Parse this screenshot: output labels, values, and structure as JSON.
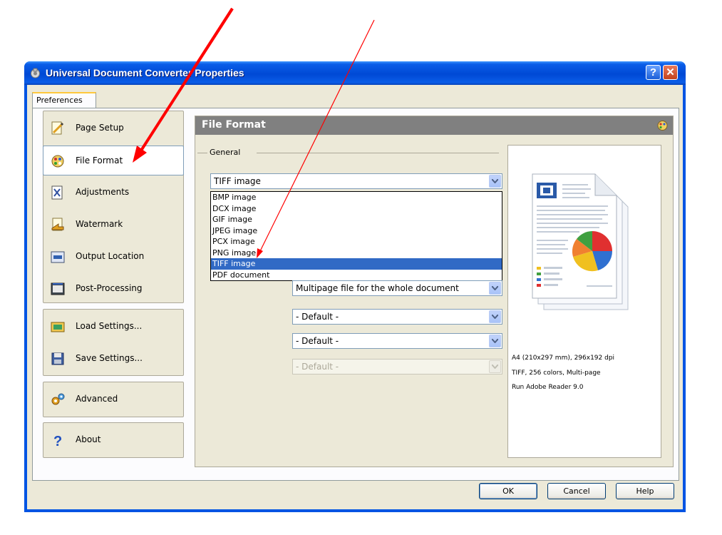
{
  "window": {
    "title": "Universal Document Converter Properties",
    "help_button": "?",
    "close_button": "✕"
  },
  "tab": {
    "label": "Preferences"
  },
  "nav": {
    "page_setup": "Page Setup",
    "file_format": "File Format",
    "adjustments": "Adjustments",
    "watermark": "Watermark",
    "output_location": "Output Location",
    "post_processing": "Post-Processing",
    "load_settings": "Load Settings...",
    "save_settings": "Save Settings...",
    "advanced": "Advanced",
    "about": "About",
    "selected": "File Format"
  },
  "content": {
    "header": "File Format",
    "group_label": "General",
    "format_select": "TIFF image",
    "format_options": [
      "BMP image",
      "DCX image",
      "GIF image",
      "JPEG image",
      "PCX image",
      "PNG image",
      "TIFF image",
      "PDF document"
    ],
    "selected_option": "TIFF image",
    "multipage_select": "Multipage file for the whole document",
    "select2": "- Default -",
    "select3": "- Default -",
    "select4": "- Default -"
  },
  "preview": {
    "line1": "A4 (210x297 mm), 296x192 dpi",
    "line2": "TIFF, 256 colors, Multi-page",
    "line3": "Run Adobe Reader 9.0"
  },
  "buttons": {
    "ok": "OK",
    "cancel": "Cancel",
    "help": "Help"
  },
  "colors": {
    "title_bar": "#0054e3",
    "selection": "#316ac5",
    "annotation_arrow": "#ff0000",
    "pie": [
      "#e03030",
      "#40a040",
      "#3070d0",
      "#f0c020",
      "#f08030"
    ]
  }
}
